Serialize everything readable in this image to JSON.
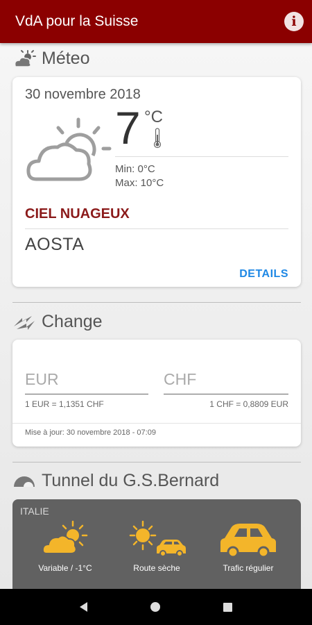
{
  "app": {
    "title": "VdA pour la Suisse",
    "info_icon": "info-icon",
    "accent": "#8b0000"
  },
  "meteo": {
    "section_title": "Méteo",
    "date": "30 novembre 2018",
    "temperature": "7",
    "unit": "°C",
    "min": "Min: 0°C",
    "max": "Max: 10°C",
    "condition": "CIEL NUAGEUX",
    "city": "AOSTA",
    "details_label": "DETAILS"
  },
  "change": {
    "section_title": "Change",
    "from_currency": "EUR",
    "to_currency": "CHF",
    "from_rate": "1 EUR = 1,1351 CHF",
    "to_rate": "1 CHF = 0,8809 EUR",
    "updated": "Mise à jour: 30 novembre 2018 - 07:09"
  },
  "tunnel": {
    "section_title": "Tunnel du G.S.Bernard",
    "country": "ITALIE",
    "items": [
      {
        "label": "Variable / -1°C",
        "icon": "partly-cloudy-icon"
      },
      {
        "label": "Route sèche",
        "icon": "sun-car-icon"
      },
      {
        "label": "Trafic régulier",
        "icon": "car-icon"
      }
    ],
    "icon_color": "#f3b52a"
  }
}
